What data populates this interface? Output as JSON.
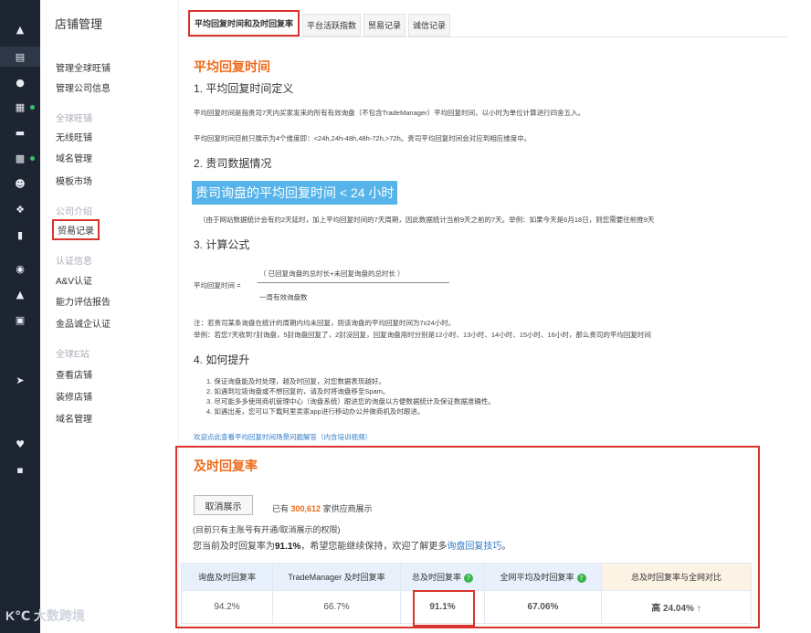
{
  "rail": {
    "icons": [
      "home-icon",
      "store-icon",
      "shield-icon",
      "apps-icon",
      "chat-icon",
      "chart-icon",
      "users-icon",
      "share-icon",
      "clipboard-icon",
      "globe-icon",
      "person-icon",
      "bank-icon",
      "send-icon",
      "heart-icon",
      "briefcase-icon"
    ]
  },
  "menu": {
    "title": "店铺管理",
    "items": {
      "manage_ww": "管理全球旺铺",
      "company_info": "管理公司信息",
      "group_global": "全球旺铺",
      "wireless": "无线旺铺",
      "domain": "域名管理",
      "template": "模板市场",
      "group_company": "公司介绍",
      "trade_records": "贸易记录",
      "group_cert": "认证信息",
      "av_cert": "A&V认证",
      "ability": "能力评估报告",
      "gold": "金品诚企认证",
      "group_site": "全球E站",
      "view_store": "查看店铺",
      "decorate": "装修店铺",
      "domain2": "域名管理"
    }
  },
  "tabs": [
    "平均回复时间和及时回复率",
    "平台活跃指数",
    "贸易记录",
    "诚信记录"
  ],
  "avg": {
    "heading": "平均回复时间",
    "s1": "1. 平均回复时间定义",
    "p1": "平均回复时间是指贵司7天内买家发来的所有有效询盘（不包含TradeManager）平均回复时间，以小时为单位计算进行四舍五入。",
    "p2": "平均回复时间目前只展示为4个维度即：<24h,24h-48h,48h-72h,>72h。贵司平均回复时间会对应到相应维度中。",
    "s2": "2. 贵司数据情况",
    "highlight": "贵司询盘的平均回复时间 < 24 小时",
    "p3": "（由于网站数据统计会有约2天延时，加上平均回复时间的7天周期，因此数据统计当前9天之前的7天。举例：如果今天是6月18日，则您需要往前推9天",
    "s3": "3. 计算公式",
    "formula_label": "平均回复时间 =",
    "formula_num": "（ 已回复询盘的总时长+未回复询盘的总时长 ）",
    "formula_den": "一周有效询盘数",
    "note1": "注：若贵司某条询盘在统计的周期内均未回复，则该询盘的平均回复时间为7x24小时。",
    "note2": "举例：若您7天收到7封询盘，5封询盘回复了，2封没回复，回复询盘用时分别是12小时、13小时、14小时、15小时、16小时，那么贵司的平均回复时间",
    "s4": "4. 如何提升",
    "tips": [
      "1. 保证询盘能及时处理，越及时回复，对您数据表现越好。",
      "2. 如遇到垃圾询盘或不想回复的，请及时将询盘移至Spam。",
      "3. 尽可能多多使用商机管理中心（询盘系统）跟进您的询盘以方便数据统计及保证数据准确性。",
      "4. 如遇出差，您可以下载阿里卖家app进行移动办公并做商机及时跟进。"
    ],
    "link": "欢迎点此查看平均回复时间场景问题解答（内含培训视频）"
  },
  "rate": {
    "heading": "及时回复率",
    "button": "取消展示",
    "count_prefix": "已有",
    "count": "300,612",
    "count_suffix": "家供应商展示",
    "perm_note": "(目前只有主账号有开通/取消展示的权限)",
    "msg_prefix": "您当前及时回复率为",
    "msg_rate": "91.1%",
    "msg_mid": "，希望您能继续保持，欢迎了解更多",
    "msg_link": "询盘回复技巧",
    "msg_end": "。",
    "headers": [
      "询盘及时回复率",
      "TradeManager 及时回复率",
      "总及时回复率",
      "全网平均及时回复率",
      "总及时回复率与全网对比"
    ],
    "values": [
      "94.2%",
      "66.7%",
      "91.1%",
      "67.06%",
      "高 24.04% ↑"
    ]
  },
  "watermark": "K℃ 大数跨境"
}
